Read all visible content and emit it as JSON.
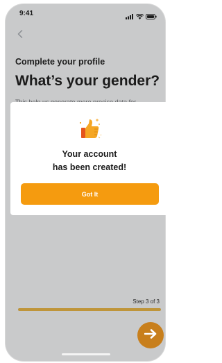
{
  "status_bar": {
    "time": "9:41"
  },
  "profile": {
    "subtitle": "Complete your profile",
    "heading": "What’s your gender?",
    "helper": "This help us generate more precise data for"
  },
  "progress": {
    "step_label": "Step 3 of 3",
    "value": 1.0
  },
  "modal": {
    "message_line1": "Your account",
    "message_line2": "has been created!",
    "button_label": "Got It",
    "icon": "thumbs-up-icon"
  },
  "colors": {
    "accent": "#f59b0f",
    "progress_fill": "#bf953a",
    "next_button": "#c87f1c",
    "overlay": "#c9cacb"
  }
}
